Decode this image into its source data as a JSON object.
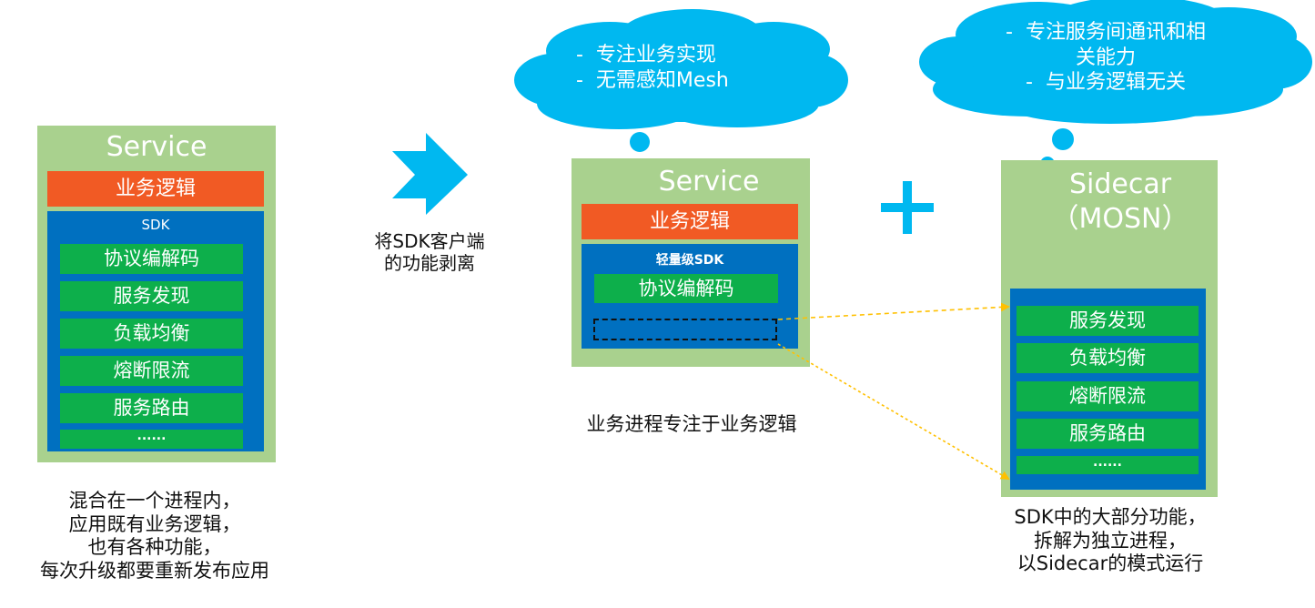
{
  "left_service": {
    "title": "Service",
    "business_logic": "业务逻辑",
    "sdk_label": "SDK",
    "sdk_items": [
      "协议编解码",
      "服务发现",
      "负载均衡",
      "熔断限流",
      "服务路由",
      "......"
    ],
    "caption": [
      "混合在一个进程内，",
      "应用既有业务逻辑，",
      "也有各种功能，",
      "每次升级都要重新发布应用"
    ]
  },
  "arrow": {
    "icon": "chevron-right-arrow-icon",
    "caption": [
      "将SDK客户端",
      "的功能剥离"
    ]
  },
  "middle_service": {
    "cloud_lines": [
      "-  专注业务实现",
      "-  无需感知Mesh"
    ],
    "title": "Service",
    "business_logic": "业务逻辑",
    "sdk_label": "轻量级SDK",
    "sdk_items": [
      "协议编解码"
    ],
    "caption": "业务进程专注于业务逻辑"
  },
  "plus": {
    "icon": "plus-icon",
    "glyph": "+"
  },
  "sidecar": {
    "cloud_lines": [
      "-  专注服务间通讯和相",
      "关能力",
      "-  与业务逻辑无关"
    ],
    "title_lines": [
      "Sidecar",
      "（MOSN）"
    ],
    "items": [
      "服务发现",
      "负载均衡",
      "熔断限流",
      "服务路由",
      "......"
    ],
    "caption": [
      "SDK中的大部分功能，",
      "拆解为独立进程，",
      "以Sidecar的模式运行"
    ]
  },
  "colors": {
    "container_green": "#a9d18e",
    "business_orange": "#f15a24",
    "sdk_blue": "#0070c0",
    "item_green": "#0daf4b",
    "cloud_cyan": "#00b8f0",
    "dashed_arrow_yellow": "#ffc000"
  }
}
